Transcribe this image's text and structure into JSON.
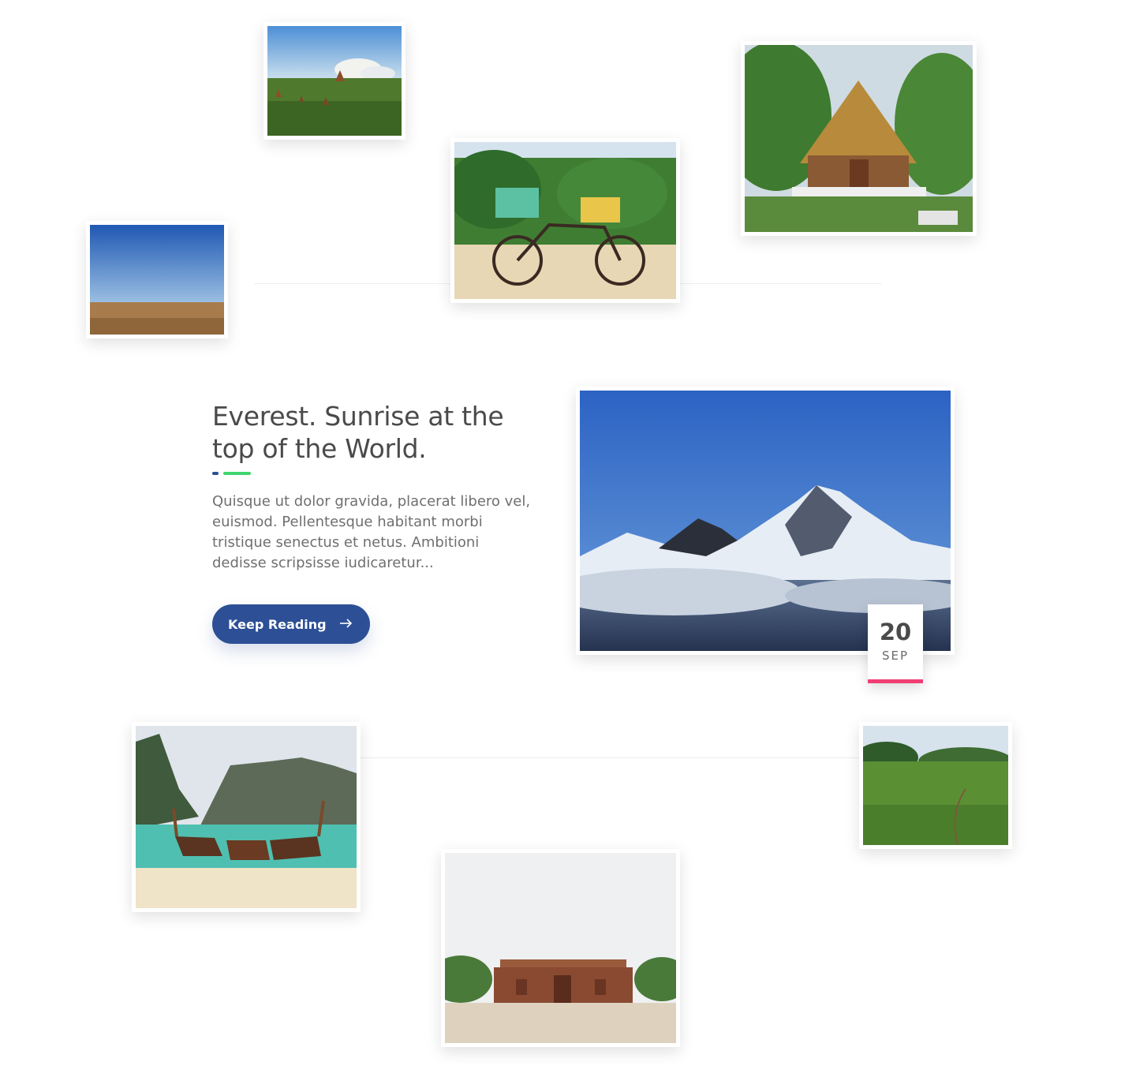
{
  "post": {
    "title": "Everest. Sunrise at the top of the World.",
    "excerpt": "Quisque ut dolor gravida, placerat libero vel, euismod. Pellentesque habitant morbi tristique senectus et netus. Ambitioni dedisse scripsisse iudicaretur...",
    "button_label": "Keep Reading",
    "date": {
      "day": "20",
      "month": "SEP"
    }
  },
  "colors": {
    "primary": "#2d4f96",
    "green_accent": "#3fd46f",
    "date_accent": "#ef3f72",
    "title_text": "#4a4a4a",
    "body_text": "#6f6f6f"
  },
  "icons": {
    "button_icon": "arrow-right-icon"
  }
}
